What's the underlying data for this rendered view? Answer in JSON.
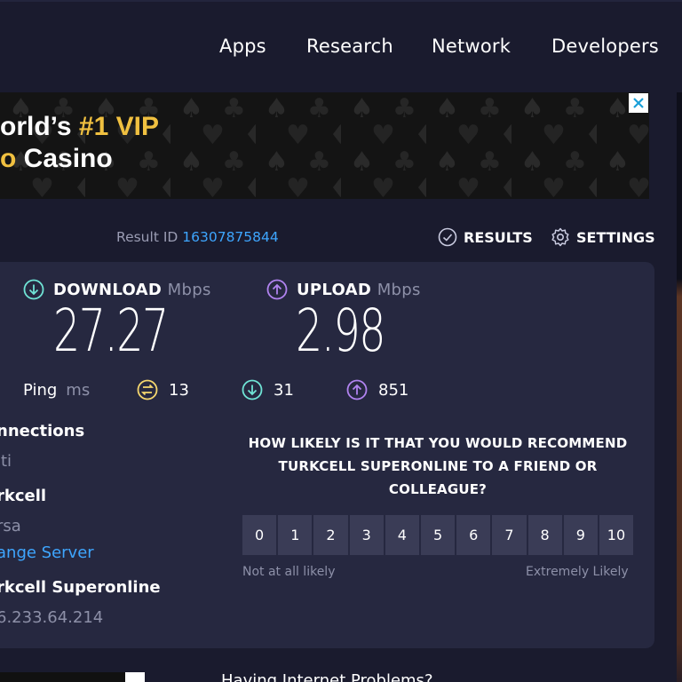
{
  "nav": {
    "items": [
      "Apps",
      "Research",
      "Network",
      "Developers"
    ]
  },
  "ad": {
    "line1_part1": "orld’s ",
    "line1_highlight": "#1 VIP",
    "line2_highlight": "o ",
    "line2_part2": "Casino",
    "close_icon": "close-icon"
  },
  "result": {
    "label": "Result ID ",
    "id": "16307875844",
    "results_label": "RESULTS",
    "settings_label": "SETTINGS"
  },
  "download": {
    "label": "DOWNLOAD",
    "unit": "Mbps",
    "value": "27.27",
    "color": "#6fe3d5"
  },
  "upload": {
    "label": "UPLOAD",
    "unit": "Mbps",
    "value": "2.98",
    "color": "#b183f0"
  },
  "ping": {
    "label": "Ping",
    "unit": "ms",
    "idle": "13",
    "download": "31",
    "upload": "851",
    "idle_color": "#f5d76e"
  },
  "connection": {
    "connections_label": "nnections",
    "connections_value": "lti",
    "server_name": "rkcell",
    "server_city": "rsa",
    "change_server": "ange Server",
    "isp_name": "rkcell Superonline",
    "ip": "6.233.64.214"
  },
  "survey": {
    "question": "HOW LIKELY IS IT THAT YOU WOULD RECOMMEND TURKCELL SUPERONLINE TO A FRIEND OR COLLEAGUE?",
    "scale": [
      "0",
      "1",
      "2",
      "3",
      "4",
      "5",
      "6",
      "7",
      "8",
      "9",
      "10"
    ],
    "low_label": "Not at all likely",
    "high_label": "Extremely Likely"
  },
  "bottom": {
    "text": "Having Internet Problems?"
  },
  "colors": {
    "background": "#1a1b2e",
    "panel": "#262840",
    "link": "#3ea6ff",
    "ad_gold": "#f0c040"
  }
}
